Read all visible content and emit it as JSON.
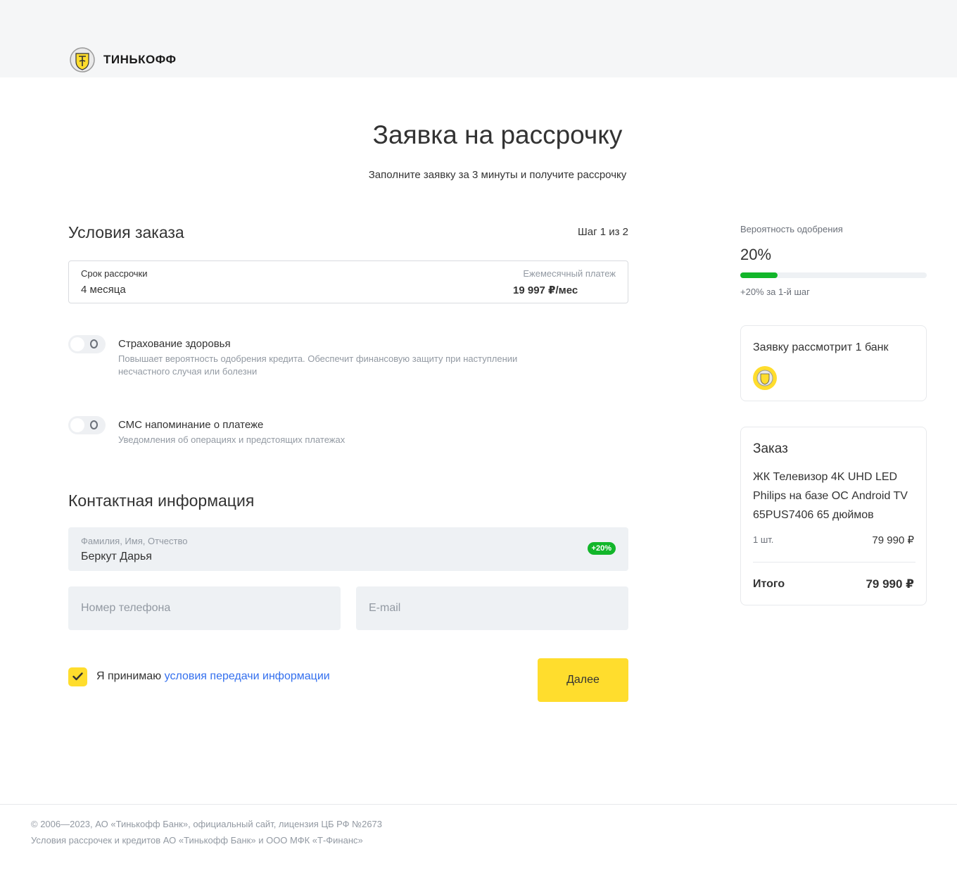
{
  "header": {
    "brand": "ТИНЬКОФФ",
    "brand_color": "#ffdd2d",
    "logo_icon": "tinkoff-emblem-icon"
  },
  "page": {
    "title": "Заявка на рассрочку",
    "subtitle": "Заполните заявку за 3 минуты и получите рассрочку"
  },
  "order_conditions": {
    "title": "Условия заказа",
    "step": "Шаг 1 из 2",
    "term_label": "Срок рассрочки",
    "term_value": "4 месяца",
    "payment_label": "Ежемесячный платеж",
    "payment_value": "19 997 ₽/мес"
  },
  "options": [
    {
      "title": "Страхование здоровья",
      "description": "Повышает вероятность одобрения кредита. Обеспечит финансовую защиту при наступлении несчастного случая или болезни",
      "enabled": false
    },
    {
      "title": "СМС напоминание о платеже",
      "description": "Уведомления об операциях и предстоящих платежах",
      "enabled": false
    }
  ],
  "contact": {
    "title": "Контактная информация",
    "name_label": "Фамилия, Имя, Отчество",
    "name_value": "Беркут Дарья",
    "name_badge": "+20%",
    "phone_placeholder": "Номер телефона",
    "email_placeholder": "E-mail"
  },
  "consent": {
    "text": "Я принимаю ",
    "link": "условия передачи информации",
    "checked": true
  },
  "actions": {
    "next_label": "Далее"
  },
  "approval": {
    "label": "Вероятность одобрения",
    "value": "20%",
    "progress": 0.2,
    "note": "+20% за 1-й шаг",
    "accent_color": "#12b62a"
  },
  "bank_card": {
    "title": "Заявку рассмотрит 1 банк",
    "bank_icon": "tinkoff-emblem-icon"
  },
  "order": {
    "title": "Заказ",
    "product": "ЖК Телевизор 4K UHD LED Philips на базе ОС Android TV 65PUS7406 65 дюймов",
    "quantity": "1 шт.",
    "price": "79 990 ₽",
    "total_label": "Итого",
    "total_value": "79 990 ₽"
  },
  "footer": {
    "line1": "© 2006—2023, АО «Тинькофф Банк», официальный сайт, лицензия ЦБ РФ №2673",
    "line2": "Условия рассрочек и кредитов АО «Тинькофф Банк» и ООО МФК «Т-Финанс»"
  }
}
